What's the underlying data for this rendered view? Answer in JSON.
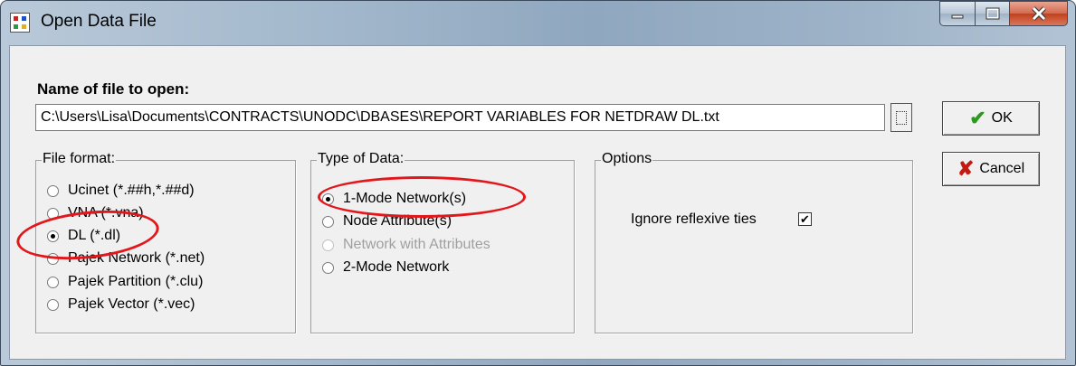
{
  "window": {
    "title": "Open Data File"
  },
  "titlebar_buttons": {
    "minimize": "minimize-icon",
    "maximize": "maximize-icon",
    "close": "close-icon"
  },
  "file_name": {
    "label": "Name of file to open:",
    "value": "C:\\Users\\Lisa\\Documents\\CONTRACTS\\UNODC\\DBASES\\REPORT VARIABLES FOR NETDRAW DL.txt"
  },
  "buttons": {
    "ok": "OK",
    "cancel": "Cancel",
    "ok_icon": "✔",
    "cancel_icon": "✘"
  },
  "file_format": {
    "legend": "File format:",
    "options": [
      "Ucinet (*.##h,*.##d)",
      "VNA (*.vna)",
      "DL (*.dl)",
      "Pajek Network (*.net)",
      "Pajek Partition (*.clu)",
      "Pajek Vector (*.vec)"
    ],
    "selected": "DL (*.dl)"
  },
  "type_of_data": {
    "legend": "Type of Data:",
    "options": [
      "1-Mode Network(s)",
      "Node Attribute(s)",
      "Network with Attributes",
      "2-Mode Network"
    ],
    "selected": "1-Mode Network(s)",
    "disabled": [
      "Network with Attributes"
    ]
  },
  "options": {
    "legend": "Options",
    "ignore_reflexive_label": "Ignore reflexive ties",
    "ignore_reflexive_checked": true
  },
  "colors": {
    "annotation": "#e3161b",
    "ok_check": "#2a9a1e",
    "cancel_x": "#c41a10"
  }
}
